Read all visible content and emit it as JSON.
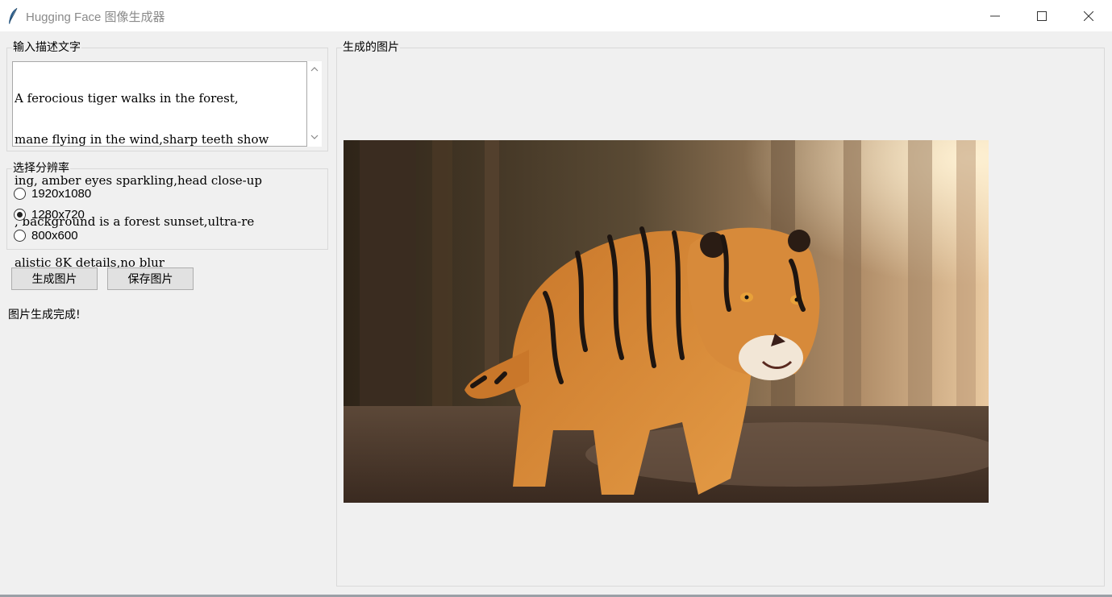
{
  "window": {
    "title": "Hugging Face 图像生成器",
    "icon": "feather-icon"
  },
  "description_group": {
    "label": "输入描述文字",
    "text_lines": [
      "A ferocious tiger walks in the forest,",
      "mane flying in the wind,sharp teeth show",
      "ing, amber eyes sparkling,head close-up",
      ", background is a forest sunset,ultra-re",
      "alistic 8K details,no blur"
    ]
  },
  "resolution_group": {
    "label": "选择分辨率",
    "options": [
      {
        "label": "1920x1080",
        "selected": false
      },
      {
        "label": "1280x720",
        "selected": true
      },
      {
        "label": "800x600",
        "selected": false
      }
    ]
  },
  "buttons": {
    "generate": "生成图片",
    "save": "保存图片"
  },
  "status": "图片生成完成!",
  "image_group": {
    "label": "生成的图片",
    "image": "tiger-in-forest-image"
  }
}
